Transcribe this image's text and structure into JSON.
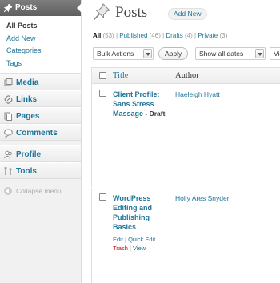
{
  "sidebar": {
    "posts_label": "Posts",
    "submenu": [
      {
        "label": "All Posts",
        "current": true
      },
      {
        "label": "Add New",
        "current": false
      },
      {
        "label": "Categories",
        "current": false
      },
      {
        "label": "Tags",
        "current": false
      }
    ],
    "menu": [
      {
        "label": "Media",
        "icon": "media-icon"
      },
      {
        "label": "Links",
        "icon": "links-icon"
      },
      {
        "label": "Pages",
        "icon": "pages-icon"
      },
      {
        "label": "Comments",
        "icon": "comments-icon"
      }
    ],
    "menu2": [
      {
        "label": "Profile",
        "icon": "profile-icon"
      },
      {
        "label": "Tools",
        "icon": "tools-icon"
      }
    ],
    "collapse_label": "Collapse menu"
  },
  "header": {
    "title": "Posts",
    "add_new": "Add New"
  },
  "filters": {
    "all": "All",
    "all_count": "(53)",
    "published": "Published",
    "published_count": "(46)",
    "drafts": "Drafts",
    "drafts_count": "(4)",
    "private": "Private",
    "private_count": "(3)",
    "sep": "|"
  },
  "tablenav": {
    "bulk_actions": "Bulk Actions",
    "apply": "Apply",
    "dates": "Show all dates",
    "view_partial": "Vie"
  },
  "table": {
    "col_title": "Title",
    "col_author": "Author",
    "rows": [
      {
        "title_lines": [
          "Client Profile:",
          "Sans Stress",
          "Massage"
        ],
        "state": " - Draft",
        "author": "Haeleigh Hyatt"
      },
      {
        "title_lines": [
          "WordPress",
          "Editing and",
          "Publishing",
          "Basics"
        ],
        "author": "Holly Ares Snyder",
        "actions": {
          "edit": "Edit",
          "quick_edit": "Quick Edit",
          "trash": "Trash",
          "view": "View",
          "sep": "|"
        }
      }
    ]
  },
  "colors": {
    "link": "#21759b",
    "trash": "#bc0b0b",
    "menu_head": "#6d6d6d"
  }
}
